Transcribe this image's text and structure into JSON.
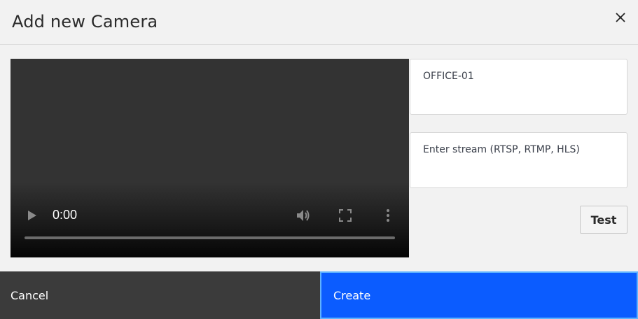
{
  "dialog": {
    "title": "Add new Camera"
  },
  "video": {
    "time": "0:00",
    "progress": 0
  },
  "form": {
    "name_value": "OFFICE-01",
    "stream_value": "",
    "stream_placeholder": "Enter stream (RTSP, RTMP, HLS)",
    "test_label": "Test"
  },
  "footer": {
    "cancel_label": "Cancel",
    "create_label": "Create"
  },
  "colors": {
    "background": "#f2f2f2",
    "cancel_bg": "#3b3b3b",
    "create_bg": "#0b5cff",
    "create_focus_border": "#5fb3ff"
  },
  "icons": [
    "close-icon",
    "play-icon",
    "volume-icon",
    "fullscreen-icon",
    "more-vertical-icon"
  ]
}
